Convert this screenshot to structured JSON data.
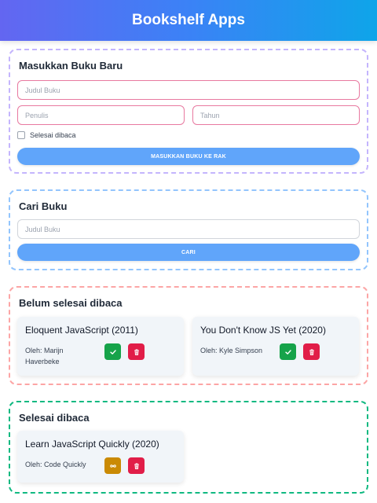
{
  "app": {
    "title": "Bookshelf Apps"
  },
  "input_section": {
    "title": "Masukkan Buku Baru",
    "title_placeholder": "Judul Buku",
    "author_placeholder": "Penulis",
    "year_placeholder": "Tahun",
    "checkbox_label": "Selesai dibaca",
    "submit_label": "MASUKKAN BUKU KE RAK"
  },
  "search_section": {
    "title": "Cari Buku",
    "placeholder": "Judul Buku",
    "button_label": "CARI"
  },
  "unread_section": {
    "title": "Belum selesai dibaca",
    "books": [
      {
        "title": "Eloquent JavaScript (2011)",
        "author": "Oleh: Marijn Haverbeke"
      },
      {
        "title": "You Don't Know JS Yet (2020)",
        "author": "Oleh: Kyle Simpson"
      }
    ]
  },
  "read_section": {
    "title": "Selesai dibaca",
    "books": [
      {
        "title": "Learn JavaScript Quickly (2020)",
        "author": "Oleh: Code Quickly"
      }
    ]
  },
  "icons": {
    "complete": "check-icon",
    "delete": "trash-icon",
    "undo": "undo-icon"
  },
  "colors": {
    "header_gradient_start": "#6366f1",
    "header_gradient_end": "#0ea5e9",
    "primary_button": "#60a5fa",
    "complete_button": "#16a34a",
    "delete_button": "#e11d48",
    "undo_button": "#ca8a04"
  }
}
